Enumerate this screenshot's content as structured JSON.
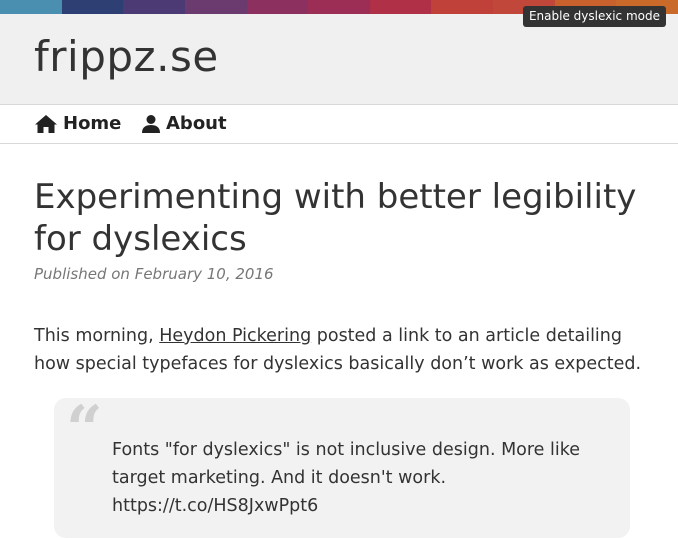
{
  "brand_colors": [
    "#4a8fb0",
    "#2e3f73",
    "#4b3a73",
    "#6b3a6e",
    "#8c3060",
    "#9c2e55",
    "#b03048",
    "#c0413a",
    "#c0473a",
    "#c8612e",
    "#c96a2a"
  ],
  "header": {
    "site_title": "frippz.se",
    "dyslexic_toggle_label": "Enable dyslexic mode"
  },
  "nav": {
    "items": [
      {
        "label": "Home",
        "icon": "home-icon"
      },
      {
        "label": "About",
        "icon": "user-icon"
      }
    ]
  },
  "article": {
    "title": "Experimenting with better legibility for dyslexics",
    "published": "Published on February 10, 2016",
    "intro_before": "This morning, ",
    "intro_link": "Heydon Pickering",
    "intro_after": " posted a link to an article detailing how special typefaces for dyslexics basically don’t work as expected.",
    "quote_mark": "“",
    "quote_text": "Fonts \"for dyslexics\" is not inclusive design. More like target marketing. And it doesn't work. https://t.co/HS8JxwPpt6"
  }
}
